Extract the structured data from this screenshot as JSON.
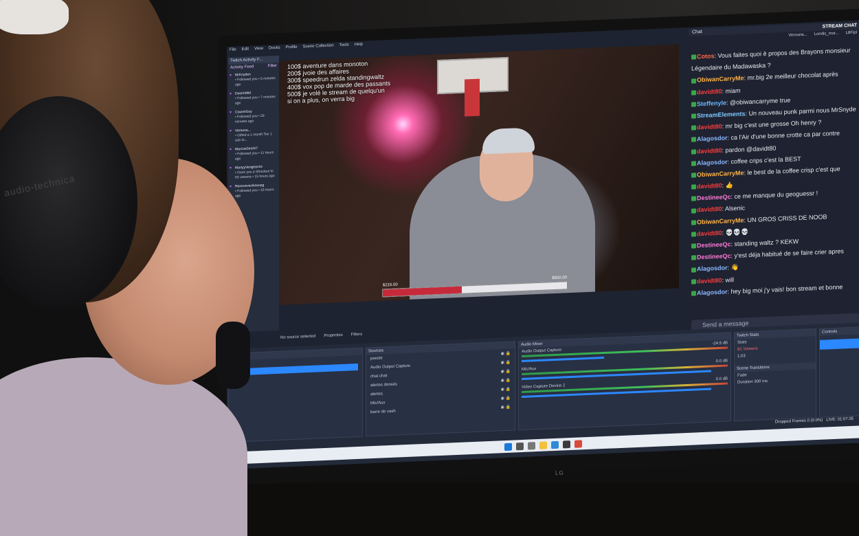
{
  "obs": {
    "menu": [
      "File",
      "Edit",
      "View",
      "Docks",
      "Profile",
      "Scene Collection",
      "Tools",
      "Help"
    ],
    "activity": {
      "title": "Twitch Activity F...",
      "feed_label": "Activity Feed",
      "filter_label": "Filter",
      "items": [
        {
          "name": "MrKnyden",
          "text": "• Followed you • 5 minutes ago"
        },
        {
          "name": "DoomWild",
          "text": "• Followed you • 7 minutes ago"
        },
        {
          "name": "CousinGuy",
          "text": "• Followed you • 29 minutes ago"
        },
        {
          "name": "Verouna...",
          "text": "• Gifted a 1 month Tier 1 sub to..."
        },
        {
          "name": "MarcosStrichi7",
          "text": "• Followed you • 11 hours ago"
        },
        {
          "name": "MartyyVengeance",
          "text": "• Gave you a Shoutout to 93 viewers • 15 hours ago"
        },
        {
          "name": "Renovevecikouxpg",
          "text": "• Followed you • 15 hours ago"
        }
      ]
    },
    "stream": {
      "donations": [
        "100$ aventure dans monoton",
        "200$ jvoie des affaires",
        "300$ speedrun zelda standingwaltz",
        "400$ vox pop de marde des passants",
        "500$ je volé le stream de quelqu'un",
        "si on a plus, on verra big"
      ],
      "bar_left": "$215.00",
      "bar_right": "$500.00",
      "progress": 0.43
    },
    "source_bar": {
      "no_source": "No source selected",
      "properties": "Properties",
      "filters": "Filters"
    },
    "sources": {
      "title": "Sources",
      "items": [
        "pseste",
        "Audio Output Capture",
        "chat chat",
        "alertes donsés",
        "alertes",
        "Mic/Aux",
        "barre de cash"
      ]
    },
    "mixer": {
      "title": "Audio Mixer",
      "channels": [
        {
          "name": "Audio Output Capture",
          "db": "-24.5 dB"
        },
        {
          "name": "Mic/Aux",
          "db": "0.0 dB"
        },
        {
          "name": "Video Capture Device 2",
          "db": "0.0 dB"
        }
      ]
    },
    "twitch_stats": {
      "title": "Twitch Stats",
      "stats_label": "Stats",
      "viewers": "81 Viewers",
      "time": "1:03"
    },
    "transitions": {
      "title": "Scene Transitions",
      "fade": "Fade",
      "duration_label": "Duration",
      "duration": "300 ms"
    },
    "controls": {
      "title": "Controls"
    },
    "status": {
      "dropped": "Dropped Frames 0 (0.0%)",
      "live": "LIVE: 01:07:35"
    }
  },
  "chat": {
    "panel_title": "Chat",
    "title": "STREAM CHAT",
    "top_names": [
      "Verouna...",
      "Londis_mor...",
      "L8Fipl"
    ],
    "messages": [
      {
        "user": "Cotos",
        "text": "Vous faites quoi è propos des Brayons monsieur",
        "color": "#ff6a4a"
      },
      {
        "user": "",
        "text": "Légendaire du Madawaska ?",
        "color": "#ffffff"
      },
      {
        "user": "ObiwanCarryMe",
        "text": "mr.big 2e meilleur chocolat après",
        "color": "#ffb347"
      },
      {
        "user": "davidt80",
        "text": "miam",
        "color": "#ff3b3b"
      },
      {
        "user": "Steffenyle",
        "text": "@obiwancarryme true",
        "color": "#6ab7ff"
      },
      {
        "user": "StreamElements",
        "text": "Un nouveau punk parmi nous MrSnyde",
        "color": "#7fc8ff"
      },
      {
        "user": "davidt80",
        "text": "mr big c'est une grosse Oh henry ?",
        "color": "#ff3b3b"
      },
      {
        "user": "Alagosdor",
        "text": "ca l'Air d'une bonne crotte ca par contre",
        "color": "#8ab8ff"
      },
      {
        "user": "davidt80",
        "text": "pardon @davidt80",
        "color": "#ff3b3b"
      },
      {
        "user": "Alagosdor",
        "text": "coffee crips c'est la BEST",
        "color": "#8ab8ff"
      },
      {
        "user": "ObiwanCarryMe",
        "text": "le best de la coffee crisp c'est que",
        "color": "#ffb347"
      },
      {
        "user": "davidt80",
        "text": "👍",
        "color": "#ff3b3b"
      },
      {
        "user": "DestineeQc",
        "text": "ce me manque du geoguessr !",
        "color": "#ff7ad9"
      },
      {
        "user": "davidt80",
        "text": "Alsenic",
        "color": "#ff3b3b"
      },
      {
        "user": "ObiwanCarryMe",
        "text": "UN GROS CRISS DE NOOB",
        "color": "#ffb347"
      },
      {
        "user": "davidt80",
        "text": "💀💀💀",
        "color": "#ff3b3b"
      },
      {
        "user": "DestineeQc",
        "text": "standing waltz ? KEKW",
        "color": "#ff7ad9"
      },
      {
        "user": "DestineeQc",
        "text": "y'est déja habitué de se faire crier apres",
        "color": "#ff7ad9"
      },
      {
        "user": "Alagosdor",
        "text": "👋",
        "color": "#8ab8ff"
      },
      {
        "user": "davidt80",
        "text": "will",
        "color": "#ff3b3b"
      },
      {
        "user": "Alagosdor",
        "text": "hey big moi j'y vais! bon stream et bonne",
        "color": "#8ab8ff"
      }
    ],
    "send_placeholder": "Send a message"
  },
  "monitor_brand": "LG",
  "headset_brand": "audio-technica"
}
